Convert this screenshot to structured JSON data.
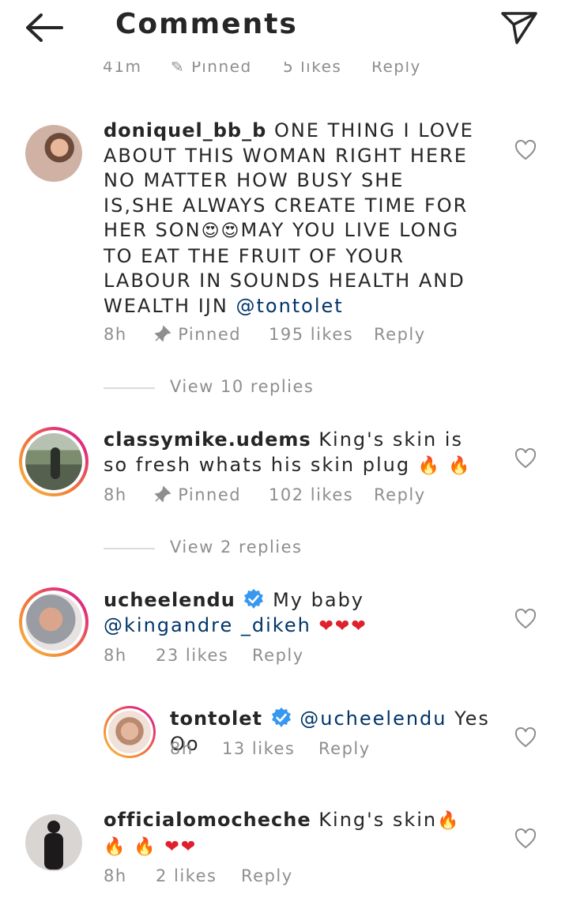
{
  "header": {
    "title": "Comments"
  },
  "ghost_meta": {
    "time": "41m",
    "pinned": "Pinned",
    "likes": "5 likes",
    "reply": "Reply"
  },
  "comments": [
    {
      "username": "doniquel_bb_b",
      "text": "ONE THING I LOVE ABOUT THIS WOMAN RIGHT HERE NO MATTER HOW BUSY SHE IS,SHE ALWAYS CREATE TIME FOR HER SON",
      "emojis": "😍😍",
      "text2": "MAY YOU LIVE LONG TO EAT THE FRUIT OF YOUR LABOUR IN SOUNDS HEALTH AND WEALTH IJN",
      "mention": "@tontolet",
      "time": "8h",
      "pinned": "Pinned",
      "likes": "195 likes",
      "reply": "Reply",
      "view_replies": "View 10 replies"
    },
    {
      "username": "classymike.udems",
      "text": "King's skin is so fresh whats his skin plug",
      "emojis": "🔥 🔥",
      "time": "8h",
      "pinned": "Pinned",
      "likes": "102 likes",
      "reply": "Reply",
      "view_replies": "View 2 replies"
    },
    {
      "username": "ucheelendu",
      "text": "My baby",
      "mention": "@kingandre _dikeh",
      "emojis": "❤❤❤",
      "time": "8h",
      "likes": "23 likes",
      "reply": "Reply"
    },
    {
      "username": "tontolet",
      "mention": "@ucheelendu",
      "text": "Yes Oo",
      "time": "8h",
      "likes": "13 likes",
      "reply": "Reply"
    },
    {
      "username": "officialomocheche",
      "text": "King's skin",
      "emojis": "🔥 🔥 🔥",
      "emojis2": "❤❤",
      "time": "8h",
      "likes": "2 likes",
      "reply": "Reply"
    }
  ],
  "colors": {
    "text": "#262626",
    "secondary": "#8e8e8e",
    "mention": "#003569",
    "verified": "#3897f0"
  }
}
